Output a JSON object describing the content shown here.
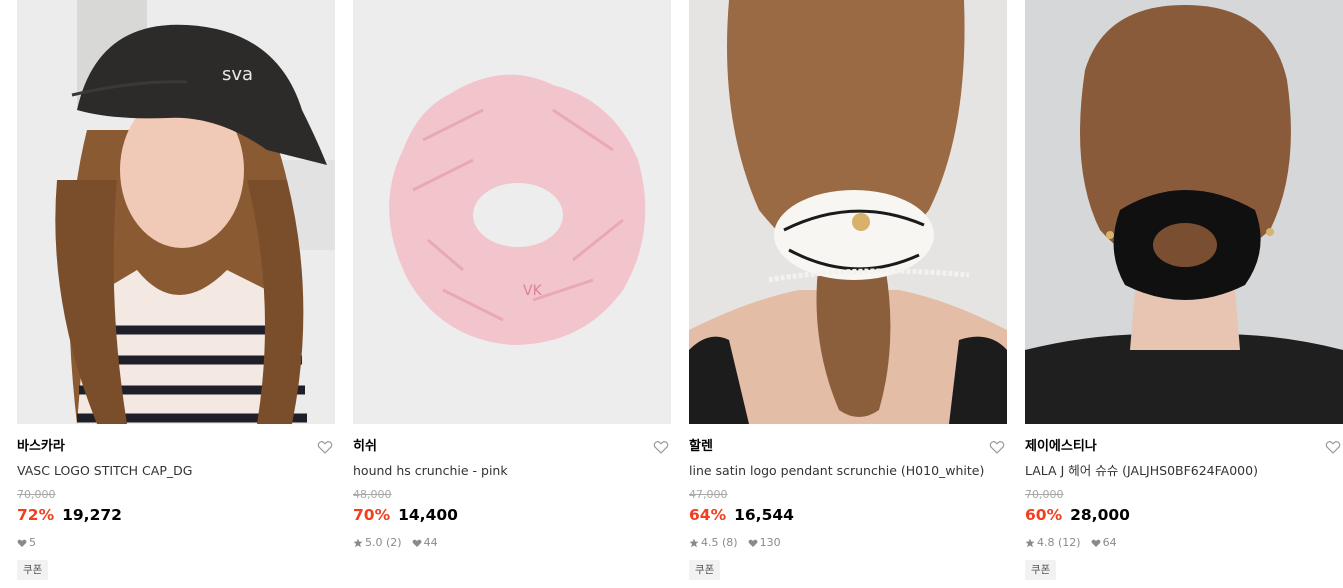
{
  "products": [
    {
      "brand": "바스카라",
      "name": "VASC LOGO STITCH CAP_DG",
      "original_price": "70,000",
      "discount": "72%",
      "price": "19,272",
      "rating": "",
      "likes": "5",
      "coupon": "쿠폰",
      "image": "woman-in-black-cap-photo"
    },
    {
      "brand": "히쉬",
      "name": "hound hs crunchie - pink",
      "original_price": "48,000",
      "discount": "70%",
      "price": "14,400",
      "rating": "5.0 (2)",
      "likes": "44",
      "coupon": "",
      "image": "pink-houndstooth-scrunchie-photo"
    },
    {
      "brand": "할렌",
      "name": "line satin logo pendant scrunchie (H010_white)",
      "original_price": "47,000",
      "discount": "64%",
      "price": "16,544",
      "rating": "4.5 (8)",
      "likes": "130",
      "coupon": "쿠폰",
      "image": "white-satin-scrunchie-photo"
    },
    {
      "brand": "제이에스티나",
      "name": "LALA J 헤어 슈슈 (JALJHS0BF624FA000)",
      "original_price": "70,000",
      "discount": "60%",
      "price": "28,000",
      "rating": "4.8 (12)",
      "likes": "64",
      "coupon": "쿠폰",
      "image": "black-satin-scrunchie-photo"
    }
  ],
  "colors": {
    "discount": "#f0401f",
    "muted": "#8a8a8a",
    "strike": "#a8a8a8"
  },
  "icons": {
    "wishlist": "heart-outline-icon",
    "rating": "star-icon",
    "likes": "heart-filled-icon"
  }
}
